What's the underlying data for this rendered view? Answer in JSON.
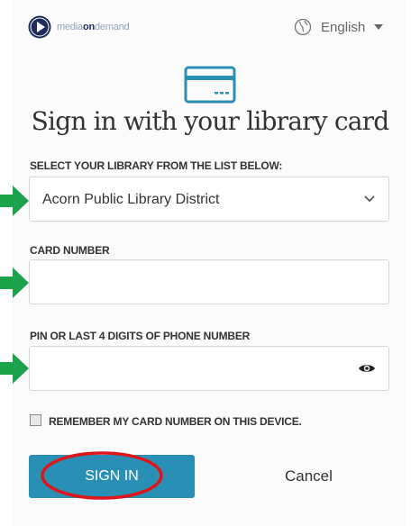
{
  "header": {
    "logo_prefix": "media",
    "logo_bold": "on",
    "logo_suffix": "demand",
    "language": "English"
  },
  "title": "Sign in with your library card",
  "library": {
    "label": "SELECT YOUR LIBRARY FROM THE LIST BELOW:",
    "selected": "Acorn Public Library District"
  },
  "card_number": {
    "label": "CARD NUMBER",
    "value": ""
  },
  "pin": {
    "label": "PIN OR LAST 4 DIGITS OF PHONE NUMBER",
    "value": ""
  },
  "remember": {
    "label": "REMEMBER MY CARD NUMBER ON THIS DEVICE.",
    "checked": false
  },
  "actions": {
    "sign_in": "SIGN IN",
    "cancel": "Cancel"
  },
  "colors": {
    "accent": "#2a8fb5",
    "annotation_arrow": "#1aa34a",
    "annotation_ring": "#e0141b"
  },
  "icons": [
    "media-on-demand-logo-icon",
    "globe-icon",
    "caret-down-icon",
    "library-card-icon",
    "chevron-down-icon",
    "eye-icon",
    "arrow-right-icon"
  ]
}
